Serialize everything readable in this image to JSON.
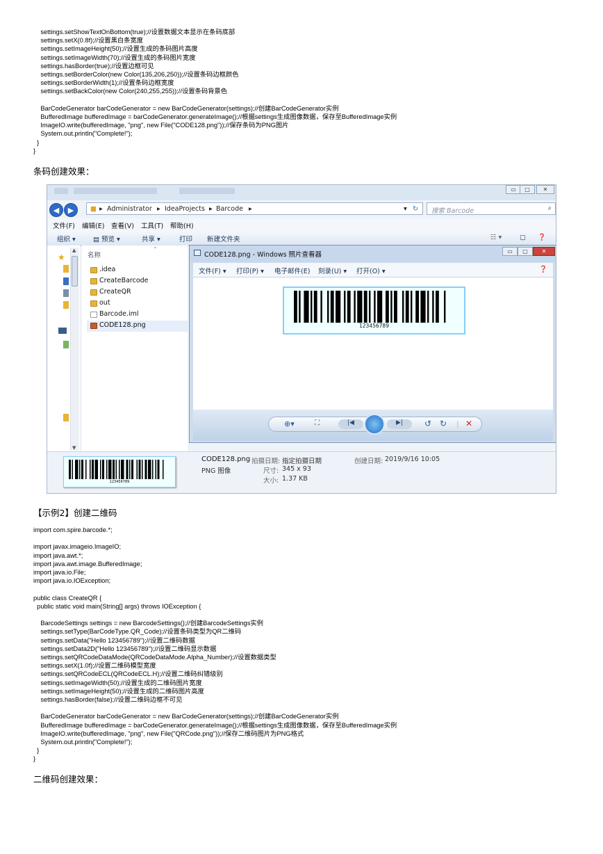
{
  "code_block_1": [
    "    settings.setShowTextOnBottom(true);//设置数据文本显示在条码底部",
    "    settings.setX(0.8f);//设置黑白条宽度",
    "    settings.setImageHeight(50);//设置生成的条码图片高度",
    "    settings.setImageWidth(70);//设置生成的条码图片宽度",
    "    settings.hasBorder(true);//设置边框可见",
    "    settings.setBorderColor(new Color(135,206,250));//设置条码边框颜色",
    "    settings.setBorderWidth(1);//设置条码边框宽度",
    "    settings.setBackColor(new Color(240,255,255));//设置条码背景色",
    "",
    "    BarCodeGenerator barCodeGenerator = new BarCodeGenerator(settings);//创建BarCodeGenerator实例",
    "    BufferedImage bufferedImage = barCodeGenerator.generateImage();//根据settings生成图像数据，保存至BufferedImage实例",
    "    ImageIO.write(bufferedImage, \"png\", new File(\"CODE128.png\"));//保存条码为PNG图片",
    "    System.out.println(\"Complete!\");",
    "  }",
    "}"
  ],
  "heading_barcode_result": "条码创建效果：",
  "screenshot": {
    "address": {
      "crumbs": [
        "Administrator",
        "IdeaProjects",
        "Barcode"
      ],
      "search_placeholder": "搜索 Barcode"
    },
    "menu": [
      "文件(F)",
      "编辑(E)",
      "查看(V)",
      "工具(T)",
      "帮助(H)"
    ],
    "toolbar": [
      "组织 ▾",
      "预览 ▾",
      "共享 ▾",
      "打印",
      "新建文件夹"
    ],
    "column_header": "名称",
    "files": [
      ".idea",
      "CreateBarcode",
      "CreateQR",
      "out",
      "Barcode.iml",
      "CODE128.png"
    ],
    "viewer": {
      "title": "CODE128.png - Windows 照片查看器",
      "menu": [
        "文件(F) ▾",
        "打印(P) ▾",
        "电子邮件(E)",
        "刻录(U) ▾",
        "打开(O) ▾"
      ],
      "barcode_text": "123456789"
    },
    "details": {
      "filename": "CODE128.png",
      "type": "PNG 图像",
      "shot_date_label": "拍摄日期:",
      "shot_date_value": "指定拍摄日期",
      "dimensions_label": "尺寸:",
      "dimensions_value": "345 x 93",
      "size_label": "大小:",
      "size_value": "1.37 KB",
      "created_label": "创建日期:",
      "created_value": "2019/9/16 10:05",
      "thumb_text": "123456789"
    }
  },
  "heading_example2": "【示例2】创建二维码",
  "code_block_2": [
    "import com.spire.barcode.*;",
    "",
    "import javax.imageio.ImageIO;",
    "import java.awt.*;",
    "import java.awt.image.BufferedImage;",
    "import java.io.File;",
    "import java.io.IOException;",
    "",
    "public class CreateQR {",
    "  public static void main(String[] args) throws IOException {",
    "",
    "    BarcodeSettings settings = new BarcodeSettings();//创建BarcodeSettings实例",
    "    settings.setType(BarCodeType.QR_Code);//设置条码类型为QR二维码",
    "    settings.setData(\"Hello 123456789\");//设置二维码数据",
    "    settings.setData2D(\"Hello 123456789\");//设置二维码显示数据",
    "    settings.setQRCodeDataMode(QRCodeDataMode.Alpha_Number);//设置数据类型",
    "    settings.setX(1.0f);//设置二维码模型宽度",
    "    settings.setQRCodeECL(QRCodeECL.H);//设置二维码纠错级别",
    "    settings.setImageWidth(50);//设置生成的二维码图片宽度",
    "    settings.setImageHeight(50);//设置生成的二维码图片高度",
    "    settings.hasBorder(false);//设置二维码边框不可见",
    "",
    "    BarCodeGenerator barCodeGenerator = new BarCodeGenerator(settings);//创建BarCodeGenerator实例",
    "    BufferedImage bufferedImage = barCodeGenerator.generateImage();//根据settings生成图像数据，保存至BufferedImage实例",
    "    ImageIO.write(bufferedImage, \"png\", new File(\"QRCode.png\"));//保存二维码图片为PNG格式",
    "    System.out.println(\"Complete!\");",
    "  }",
    "}"
  ],
  "heading_qr_result": "二维码创建效果："
}
